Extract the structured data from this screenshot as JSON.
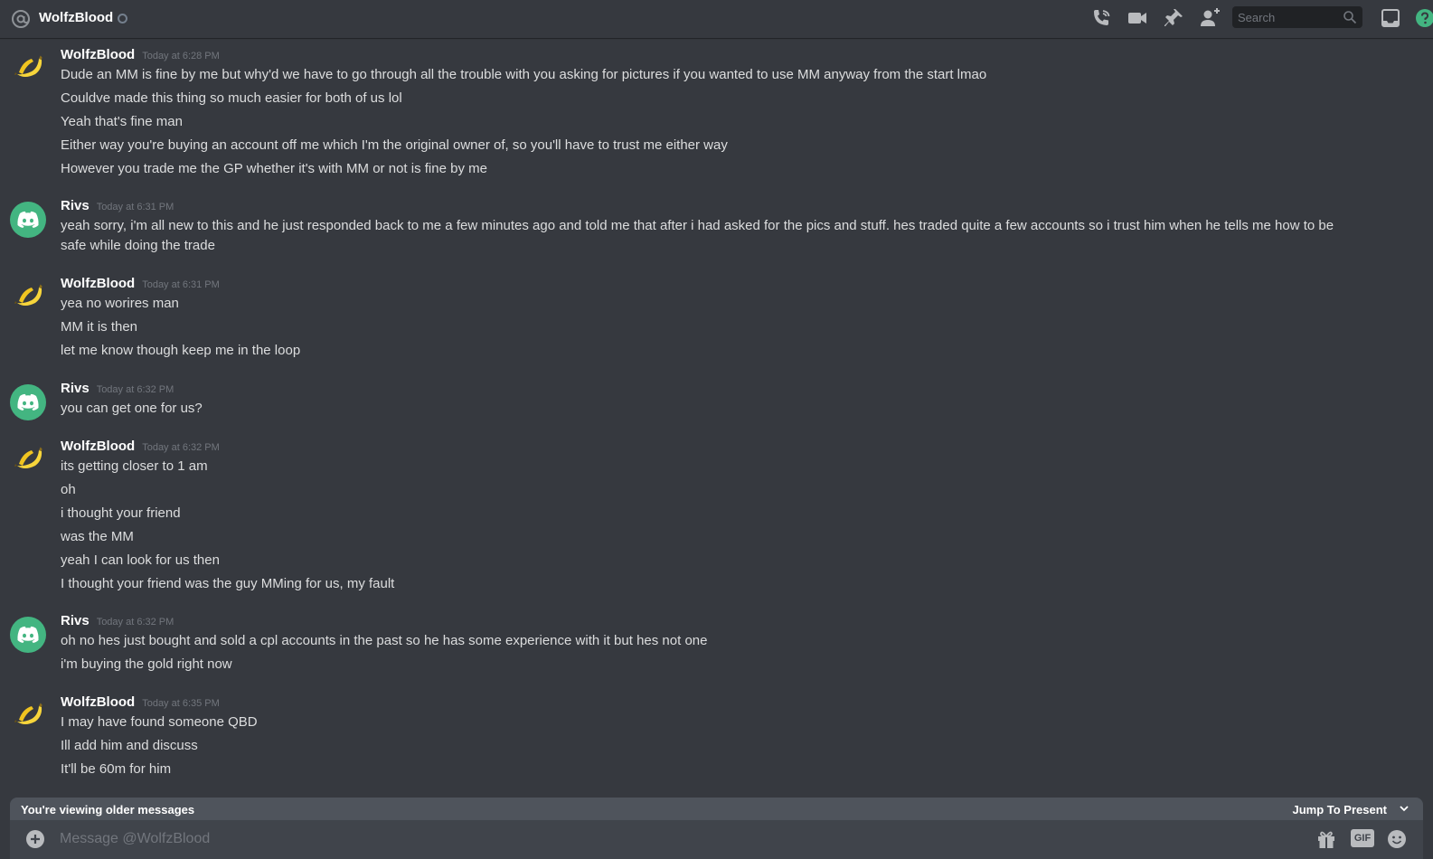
{
  "header": {
    "title": "WolfzBlood",
    "search_placeholder": "Search"
  },
  "colors": {
    "background": "#36393f",
    "online_green": "#43b581",
    "help_green": "#43b581",
    "banana_yellow": "#f7d53b"
  },
  "icons": [
    "at-icon",
    "call-icon",
    "video-icon",
    "pin-icon",
    "add-friend-icon",
    "search-icon",
    "inbox-icon",
    "help-icon",
    "plus-icon",
    "gift-icon",
    "gif-icon",
    "emoji-icon",
    "chevron-down-icon"
  ],
  "messages": [
    {
      "author": "WolfzBlood",
      "timestamp": "Today at 6:28 PM",
      "avatar": "banana",
      "lines": [
        "Dude an MM is fine by me but why'd we have to go through all the trouble with you asking for pictures if you wanted to use MM anyway from the start lmao",
        "Couldve made this thing so much easier for both of us lol",
        "Yeah that's fine man",
        "Either way you're buying an account off me which I'm the original owner of, so you'll have to trust me either way",
        "However you trade me the GP whether it's with MM or not is fine by me"
      ]
    },
    {
      "author": "Rivs",
      "timestamp": "Today at 6:31 PM",
      "avatar": "discord",
      "lines": [
        "yeah sorry, i'm all new to this and he just responded back to me a few minutes ago and told me that after i had asked for the pics and stuff. hes traded quite a few accounts so i trust him when he tells me how to be safe while doing the trade"
      ]
    },
    {
      "author": "WolfzBlood",
      "timestamp": "Today at 6:31 PM",
      "avatar": "banana",
      "lines": [
        "yea no worires man",
        "MM it is then",
        "let me know though keep me in the loop"
      ]
    },
    {
      "author": "Rivs",
      "timestamp": "Today at 6:32 PM",
      "avatar": "discord",
      "lines": [
        "you can get one for us?"
      ]
    },
    {
      "author": "WolfzBlood",
      "timestamp": "Today at 6:32 PM",
      "avatar": "banana",
      "lines": [
        "its getting closer to 1 am",
        "oh",
        "i thought your friend",
        "was the MM",
        "yeah I can look for us then",
        "I thought your friend was the guy MMing for us, my fault"
      ]
    },
    {
      "author": "Rivs",
      "timestamp": "Today at 6:32 PM",
      "avatar": "discord",
      "lines": [
        "oh no hes just bought and sold a cpl accounts in the past so he has some experience with it but hes not one",
        "i'm buying the gold right now"
      ]
    },
    {
      "author": "WolfzBlood",
      "timestamp": "Today at 6:35 PM",
      "avatar": "banana",
      "lines": [
        "I may have found someone QBD",
        "Ill add him and discuss",
        "It'll be 60m for him"
      ]
    }
  ],
  "older_bar": {
    "text": "You're viewing older messages",
    "jump_label": "Jump To Present"
  },
  "composer": {
    "placeholder": "Message @WolfzBlood",
    "gif_label": "GIF"
  }
}
